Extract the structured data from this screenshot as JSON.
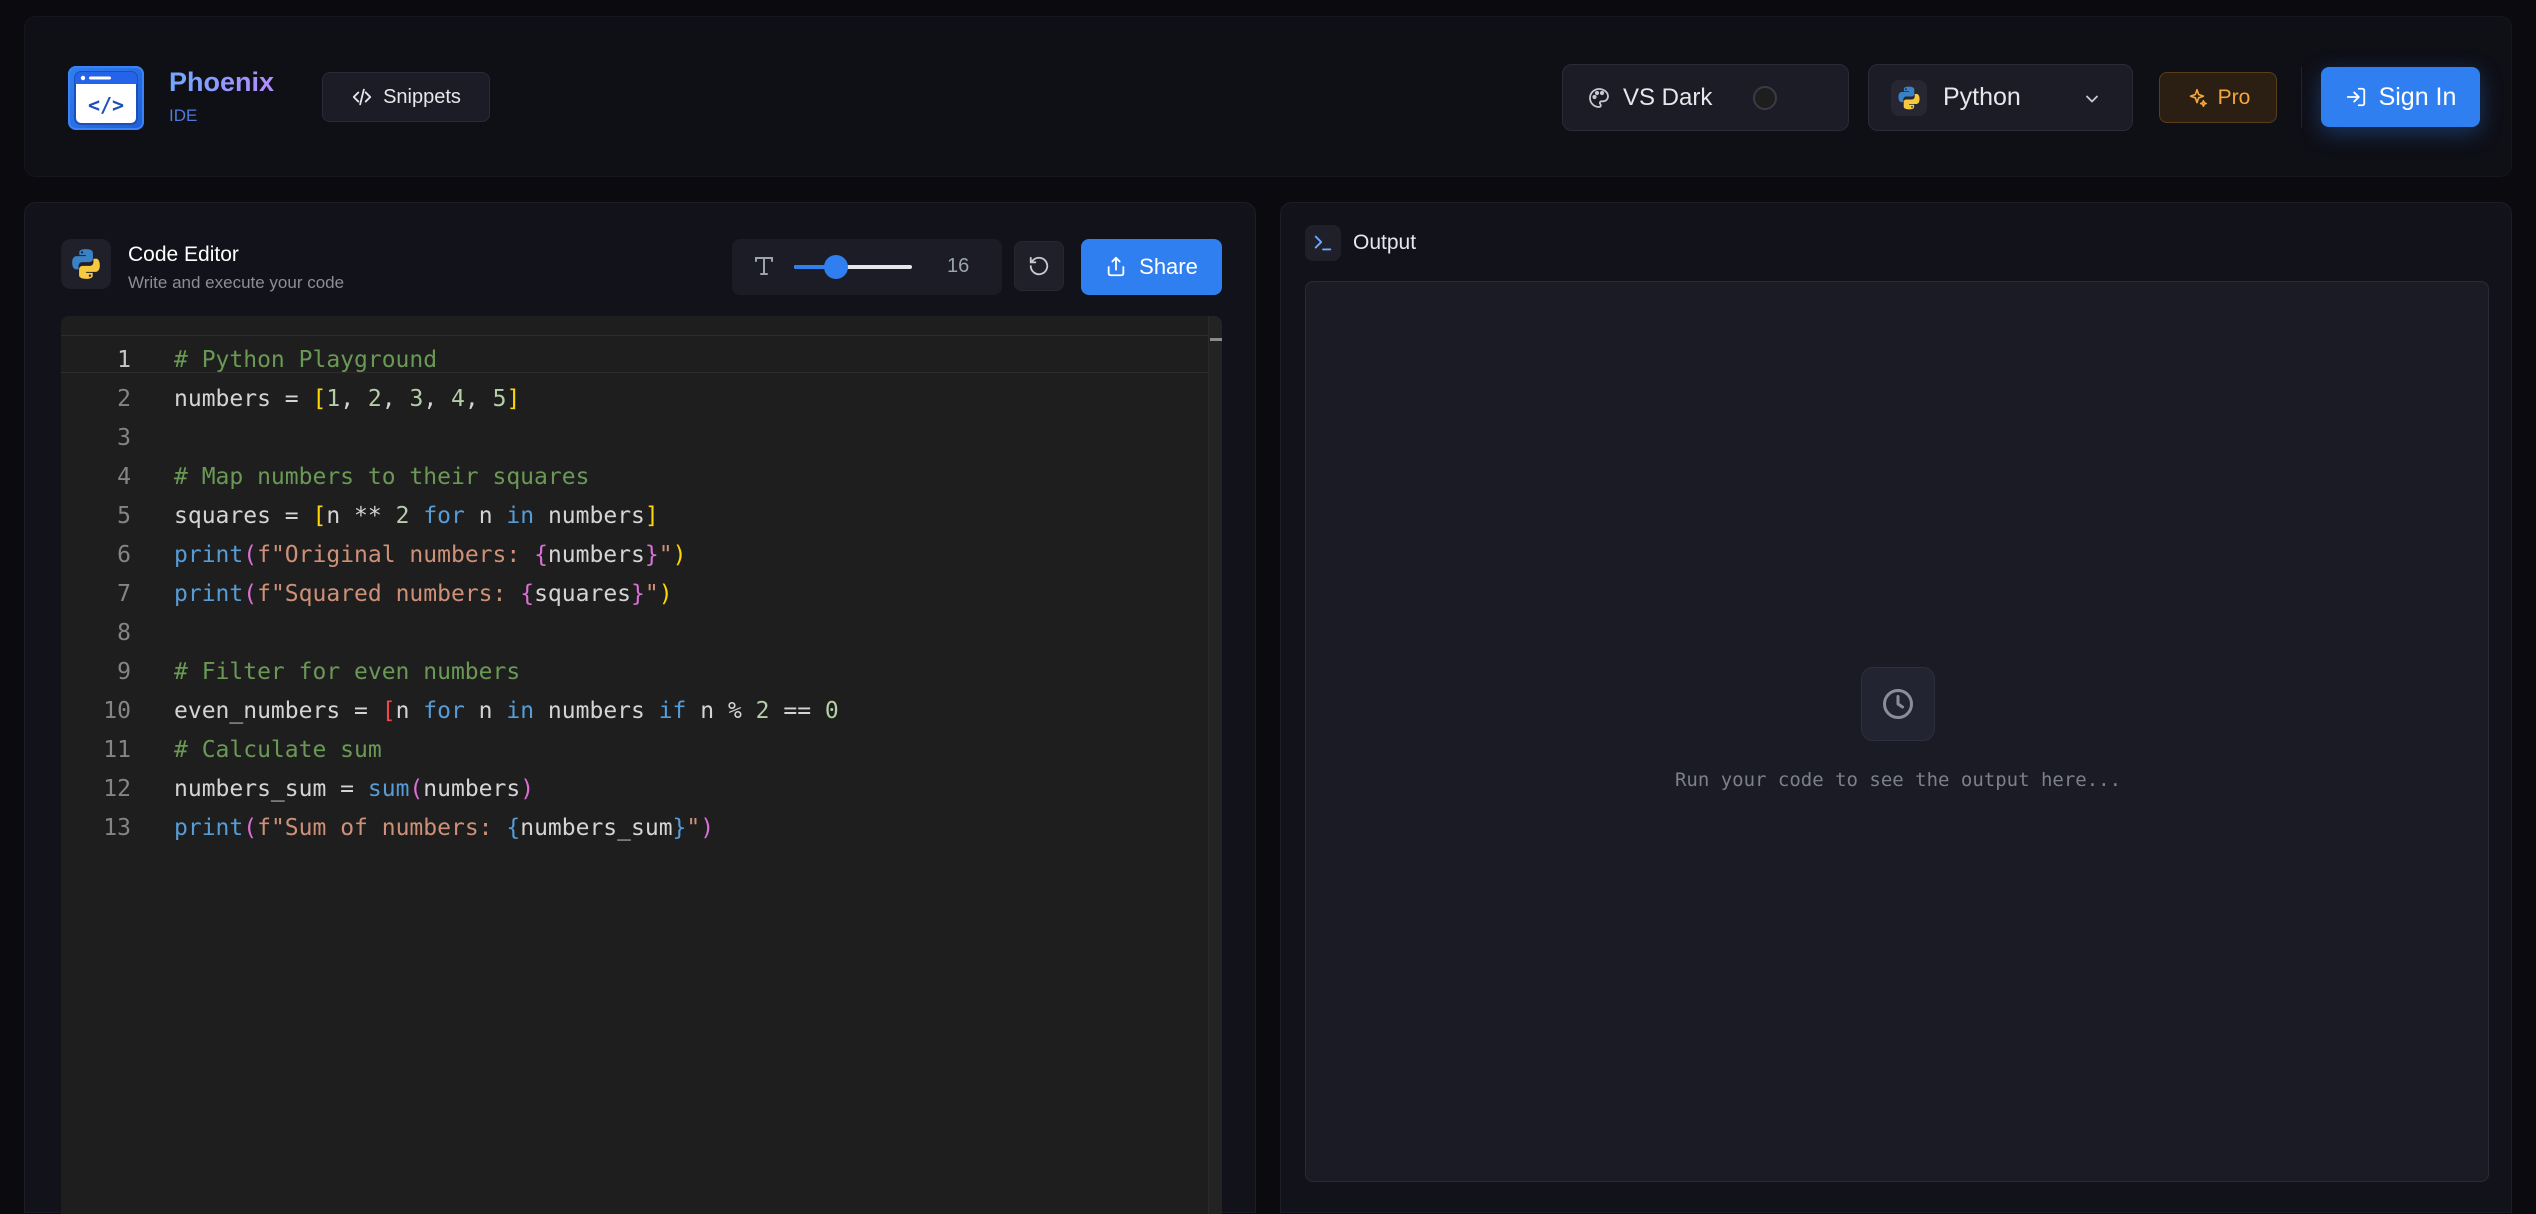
{
  "app": {
    "name": "Phoenix",
    "subtitle": "IDE",
    "snippets_label": "Snippets"
  },
  "theme_select": {
    "label": "VS Dark",
    "swatch_color": "#1e1e1e"
  },
  "language_select": {
    "label": "Python"
  },
  "pro_label": "Pro",
  "signin_label": "Sign In",
  "editor": {
    "title": "Code Editor",
    "subtitle": "Write and execute your code",
    "font_size": "16",
    "font_slider_fraction": 0.36,
    "share_label": "Share",
    "active_line": 1,
    "lines": [
      [
        {
          "t": "# Python Playground",
          "c": "#6a9955"
        }
      ],
      [
        {
          "t": "numbers = ",
          "c": "#d4d4d4"
        },
        {
          "t": "[",
          "c": "#ffd700"
        },
        {
          "t": "1",
          "c": "#b5cea8"
        },
        {
          "t": ", ",
          "c": "#d4d4d4"
        },
        {
          "t": "2",
          "c": "#b5cea8"
        },
        {
          "t": ", ",
          "c": "#d4d4d4"
        },
        {
          "t": "3",
          "c": "#b5cea8"
        },
        {
          "t": ", ",
          "c": "#d4d4d4"
        },
        {
          "t": "4",
          "c": "#b5cea8"
        },
        {
          "t": ", ",
          "c": "#d4d4d4"
        },
        {
          "t": "5",
          "c": "#b5cea8"
        },
        {
          "t": "]",
          "c": "#ffd700"
        }
      ],
      [],
      [
        {
          "t": "# Map numbers to their squares",
          "c": "#6a9955"
        }
      ],
      [
        {
          "t": "squares = ",
          "c": "#d4d4d4"
        },
        {
          "t": "[",
          "c": "#ffd700"
        },
        {
          "t": "n ** ",
          "c": "#d4d4d4"
        },
        {
          "t": "2",
          "c": "#b5cea8"
        },
        {
          "t": " ",
          "c": "#d4d4d4"
        },
        {
          "t": "for",
          "c": "#569cd6"
        },
        {
          "t": " n ",
          "c": "#d4d4d4"
        },
        {
          "t": "in",
          "c": "#569cd6"
        },
        {
          "t": " numbers",
          "c": "#d4d4d4"
        },
        {
          "t": "]",
          "c": "#ffd700"
        }
      ],
      [
        {
          "t": "print",
          "c": "#569cd6"
        },
        {
          "t": "(",
          "c": "#da70d6"
        },
        {
          "t": "f\"Original numbers: ",
          "c": "#ce9178"
        },
        {
          "t": "{",
          "c": "#da70d6"
        },
        {
          "t": "numbers",
          "c": "#d4d4d4"
        },
        {
          "t": "}",
          "c": "#da70d6"
        },
        {
          "t": "\"",
          "c": "#ce9178"
        },
        {
          "t": ")",
          "c": "#ffd700"
        }
      ],
      [
        {
          "t": "print",
          "c": "#569cd6"
        },
        {
          "t": "(",
          "c": "#da70d6"
        },
        {
          "t": "f\"Squared numbers: ",
          "c": "#ce9178"
        },
        {
          "t": "{",
          "c": "#da70d6"
        },
        {
          "t": "squares",
          "c": "#d4d4d4"
        },
        {
          "t": "}",
          "c": "#da70d6"
        },
        {
          "t": "\"",
          "c": "#ce9178"
        },
        {
          "t": ")",
          "c": "#ffd700"
        }
      ],
      [],
      [
        {
          "t": "# Filter for even numbers",
          "c": "#6a9955"
        }
      ],
      [
        {
          "t": "even_numbers = ",
          "c": "#d4d4d4"
        },
        {
          "t": "[",
          "c": "#f44747"
        },
        {
          "t": "n ",
          "c": "#d4d4d4"
        },
        {
          "t": "for",
          "c": "#569cd6"
        },
        {
          "t": " n ",
          "c": "#d4d4d4"
        },
        {
          "t": "in",
          "c": "#569cd6"
        },
        {
          "t": " numbers ",
          "c": "#d4d4d4"
        },
        {
          "t": "if",
          "c": "#569cd6"
        },
        {
          "t": " n % ",
          "c": "#d4d4d4"
        },
        {
          "t": "2",
          "c": "#b5cea8"
        },
        {
          "t": " == ",
          "c": "#d4d4d4"
        },
        {
          "t": "0",
          "c": "#b5cea8"
        }
      ],
      [
        {
          "t": "# Calculate sum",
          "c": "#6a9955"
        }
      ],
      [
        {
          "t": "numbers_sum = ",
          "c": "#d4d4d4"
        },
        {
          "t": "sum",
          "c": "#569cd6"
        },
        {
          "t": "(",
          "c": "#da70d6"
        },
        {
          "t": "numbers",
          "c": "#d4d4d4"
        },
        {
          "t": ")",
          "c": "#da70d6"
        }
      ],
      [
        {
          "t": "print",
          "c": "#569cd6"
        },
        {
          "t": "(",
          "c": "#da70d6"
        },
        {
          "t": "f\"Sum of numbers: ",
          "c": "#ce9178"
        },
        {
          "t": "{",
          "c": "#569cd6"
        },
        {
          "t": "numbers_sum",
          "c": "#d4d4d4"
        },
        {
          "t": "}",
          "c": "#569cd6"
        },
        {
          "t": "\"",
          "c": "#ce9178"
        },
        {
          "t": ")",
          "c": "#da70d6"
        }
      ]
    ]
  },
  "output": {
    "title": "Output",
    "placeholder": "Run your code to see the output here..."
  },
  "colors": {
    "accent": "#2f7ff0",
    "pro": "#f6a63a",
    "editor_bg": "#1e1e1e"
  }
}
